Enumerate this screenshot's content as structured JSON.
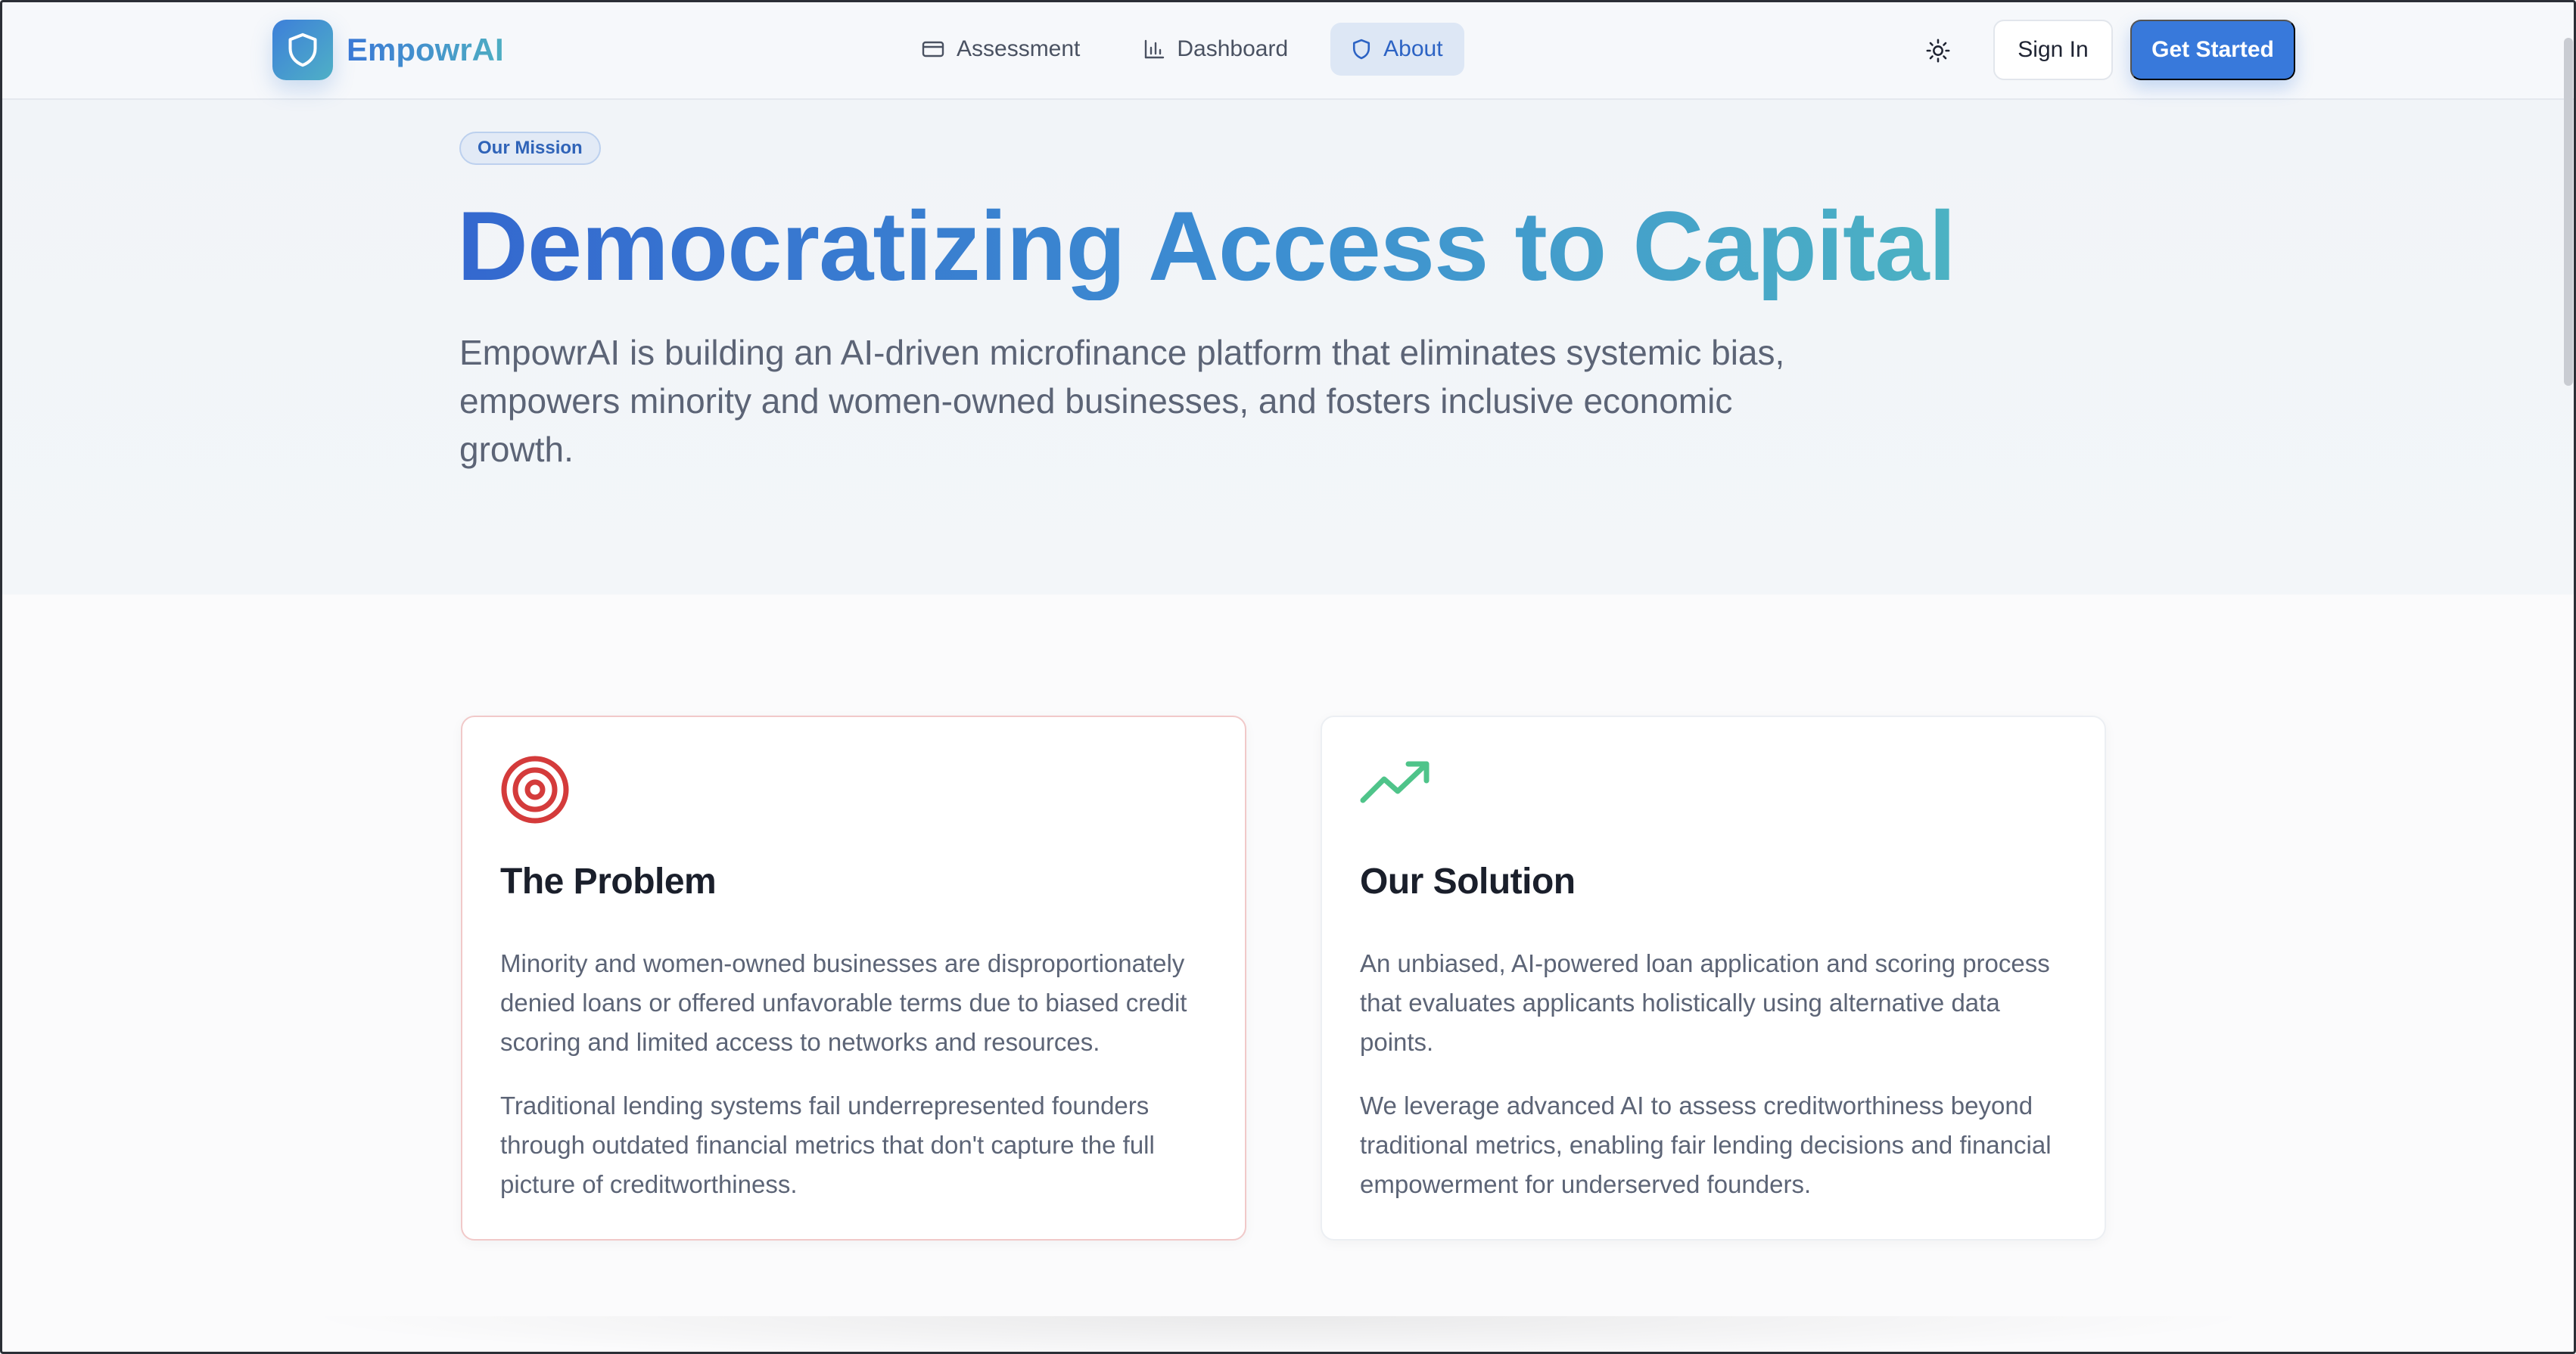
{
  "app": {
    "name": "EmpowrAI",
    "brand_colors": {
      "primary": "#3879db",
      "teal": "#4eaec2",
      "problem_red": "#d43b3b",
      "solution_green": "#4fc48a"
    }
  },
  "header": {
    "nav": [
      {
        "label": "Assessment",
        "icon": "credit-card-icon"
      },
      {
        "label": "Dashboard",
        "icon": "bar-chart-icon"
      },
      {
        "label": "About",
        "icon": "shield-icon",
        "active": true
      }
    ],
    "theme_icon": "sun-icon",
    "signin_label": "Sign In",
    "get_started_label": "Get Started"
  },
  "hero": {
    "badge": "Our Mission",
    "title": "Democratizing Access to Capital",
    "description": "EmpowrAI is building an AI-driven microfinance platform that eliminates systemic bias, empowers minority and women-owned businesses, and fosters inclusive economic growth."
  },
  "cards": [
    {
      "icon": "target-icon",
      "title": "The Problem",
      "paragraphs": [
        "Minority and women-owned businesses are disproportionately denied loans or offered unfavorable terms due to biased credit scoring and limited access to networks and resources.",
        "Traditional lending systems fail underrepresented founders through outdated financial metrics that don't capture the full picture of creditworthiness."
      ]
    },
    {
      "icon": "trending-up-icon",
      "title": "Our Solution",
      "paragraphs": [
        "An unbiased, AI-powered loan application and scoring process that evaluates applicants holistically using alternative data points.",
        "We leverage advanced AI to assess creditworthiness beyond traditional metrics, enabling fair lending decisions and financial empowerment for underserved founders."
      ]
    }
  ]
}
